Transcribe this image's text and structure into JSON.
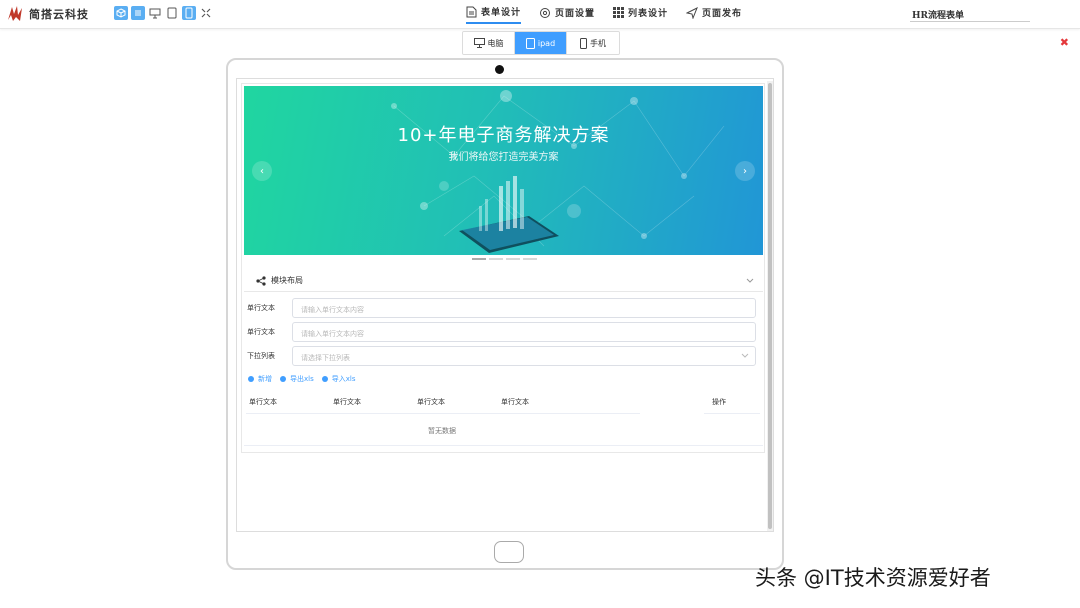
{
  "app": {
    "logo_text": "简搭云科技"
  },
  "nav": [
    {
      "label": "表单设计",
      "icon": "document-icon",
      "active": true
    },
    {
      "label": "页面设置",
      "icon": "gear-icon",
      "active": false
    },
    {
      "label": "列表设计",
      "icon": "grid-icon",
      "active": false
    },
    {
      "label": "页面发布",
      "icon": "send-icon",
      "active": false
    }
  ],
  "form_name": "HR流程表单",
  "device_tabs": [
    {
      "label": "电脑",
      "active": false
    },
    {
      "label": "ipad",
      "active": true
    },
    {
      "label": "手机",
      "active": false
    }
  ],
  "banner": {
    "title": "10+年电子商务解决方案",
    "subtitle": "我们将给您打造完美方案"
  },
  "section": {
    "title": "模块布局"
  },
  "fields": [
    {
      "label": "单行文本",
      "placeholder": "请输入单行文本内容"
    },
    {
      "label": "单行文本",
      "placeholder": "请输入单行文本内容"
    },
    {
      "label": "下拉列表",
      "placeholder": "请选择下拉列表"
    }
  ],
  "actions": [
    "新增",
    "导出xls",
    "导入xls"
  ],
  "table": {
    "columns": [
      "单行文本",
      "单行文本",
      "单行文本",
      "单行文本",
      "操作"
    ],
    "empty_text": "暂无数据"
  },
  "watermark": "头条 @IT技术资源爱好者",
  "colors": {
    "accent": "#409eff",
    "close": "#e4393c",
    "banner_start": "#20d6a0",
    "banner_end": "#2196d6"
  }
}
